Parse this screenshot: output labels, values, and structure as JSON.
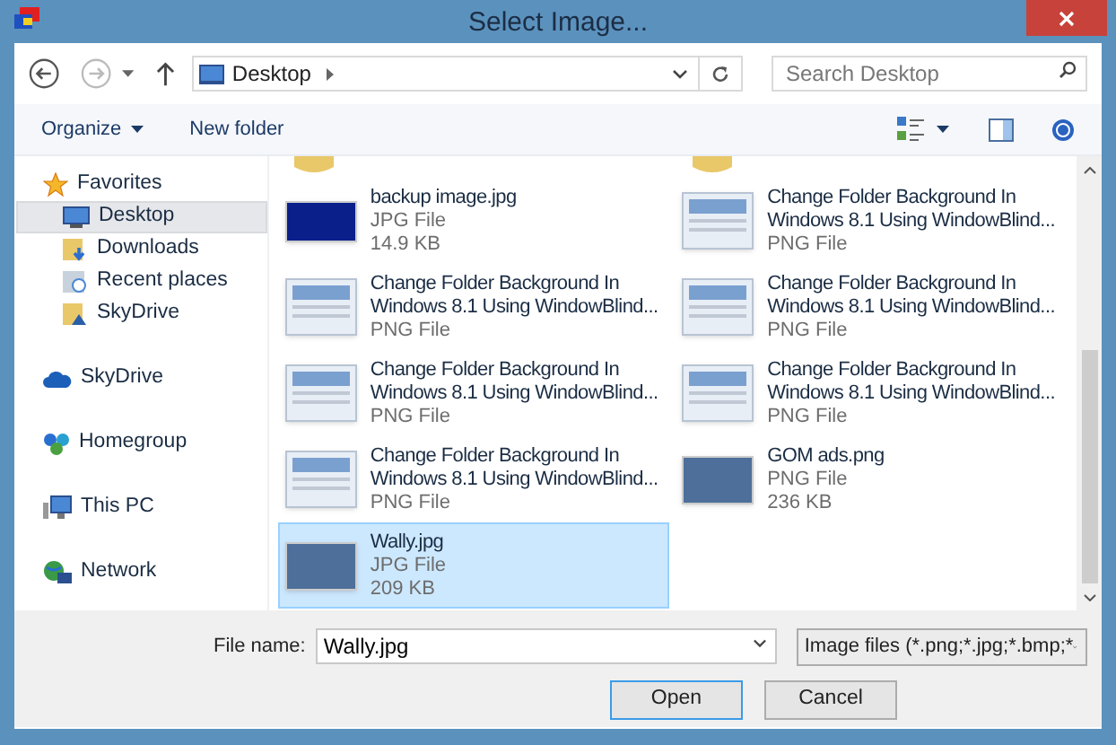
{
  "window": {
    "title": "Select Image..."
  },
  "address": {
    "location": "Desktop"
  },
  "search": {
    "placeholder": "Search Desktop"
  },
  "toolbar": [
    "Organize",
    "New folder"
  ],
  "sidebar": [
    {
      "label": "Favorites",
      "selected": false,
      "children": [
        {
          "label": "Desktop",
          "selected": true
        },
        {
          "label": "Downloads",
          "selected": false
        },
        {
          "label": "Recent places",
          "selected": false
        },
        {
          "label": "SkyDrive",
          "selected": false
        }
      ]
    },
    {
      "label": "SkyDrive",
      "selected": false
    },
    {
      "label": "Homegroup",
      "selected": false
    },
    {
      "label": "This PC",
      "selected": false
    },
    {
      "label": "Network",
      "selected": false
    }
  ],
  "files": [
    {
      "name": "backup image.jpg",
      "type": "JPG File",
      "size": "14.9 KB",
      "kind": "dark",
      "selected": false
    },
    {
      "name": "Change Folder Background In Windows 8.1 Using WindowBlind...",
      "type": "PNG File",
      "kind": "screenshot",
      "selected": false
    },
    {
      "name": "Change Folder Background In Windows 8.1 Using WindowBlind...",
      "type": "PNG File",
      "kind": "screenshot",
      "selected": false
    },
    {
      "name": "Change Folder Background In Windows 8.1 Using WindowBlind...",
      "type": "PNG File",
      "kind": "screenshot",
      "selected": false
    },
    {
      "name": "Change Folder Background In Windows 8.1 Using WindowBlind...",
      "type": "PNG File",
      "kind": "screenshot",
      "selected": false
    },
    {
      "name": "Change Folder Background In Windows 8.1 Using WindowBlind...",
      "type": "PNG File",
      "kind": "screenshot",
      "selected": false
    },
    {
      "name": "Change Folder Background In Windows 8.1 Using WindowBlind...",
      "type": "PNG File",
      "kind": "screenshot",
      "selected": false
    },
    {
      "name": "GOM ads.png",
      "type": "PNG File",
      "size": "236 KB",
      "kind": "photo",
      "selected": false
    },
    {
      "name": "Wally.jpg",
      "type": "JPG File",
      "size": "209 KB",
      "kind": "photo",
      "selected": true
    }
  ],
  "file_name": {
    "label": "File name:",
    "value": "Wally.jpg"
  },
  "filter": {
    "value": "Image files (*.png;*.jpg;*.bmp;*"
  },
  "buttons": [
    {
      "label": "Open",
      "default": true
    },
    {
      "label": "Cancel",
      "default": false
    }
  ]
}
